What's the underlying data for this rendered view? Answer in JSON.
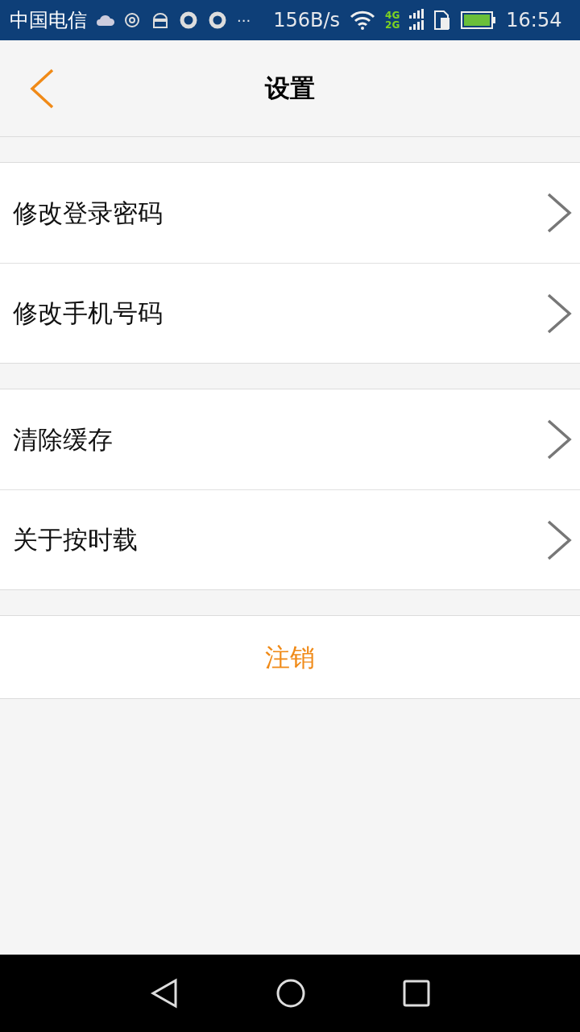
{
  "status_bar": {
    "carrier": "中国电信",
    "more": "···",
    "speed": "156B/s",
    "network_top": "4G",
    "network_bottom": "2G",
    "time": "16:54"
  },
  "header": {
    "title": "设置"
  },
  "groups": [
    {
      "items": [
        {
          "label": "修改登录密码"
        },
        {
          "label": "修改手机号码"
        }
      ]
    },
    {
      "items": [
        {
          "label": "清除缓存"
        },
        {
          "label": "关于按时载"
        }
      ]
    }
  ],
  "logout": {
    "label": "注销"
  }
}
